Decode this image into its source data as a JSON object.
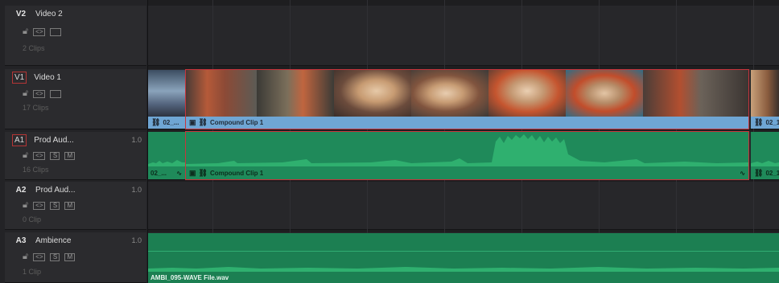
{
  "tracks": [
    {
      "id": "V2",
      "name": "Video 2",
      "volume": "",
      "clips": "2 Clips"
    },
    {
      "id": "V1",
      "name": "Video 1",
      "volume": "",
      "clips": "17 Clips"
    },
    {
      "id": "A1",
      "name": "Prod Aud...",
      "volume": "1.0",
      "clips": "16 Clips"
    },
    {
      "id": "A2",
      "name": "Prod Aud...",
      "volume": "1.0",
      "clips": "0 Clip"
    },
    {
      "id": "A3",
      "name": "Ambience",
      "volume": "1.0",
      "clips": "1 Clip"
    }
  ],
  "controls": {
    "solo": "S",
    "mute": "M"
  },
  "clips": {
    "v1_left": "02_...",
    "v1_compound": "Compound Clip 1",
    "v1_right": "02_1",
    "a1_left": "02_...",
    "a1_compound": "Compound Clip 1",
    "a1_right": "02_1",
    "a3": "AMBI_095-WAVE File.wav"
  },
  "colors": {
    "video_clip": "#6fa6d4",
    "audio_clip": "#1f8a5a",
    "selection": "#c8343c"
  }
}
